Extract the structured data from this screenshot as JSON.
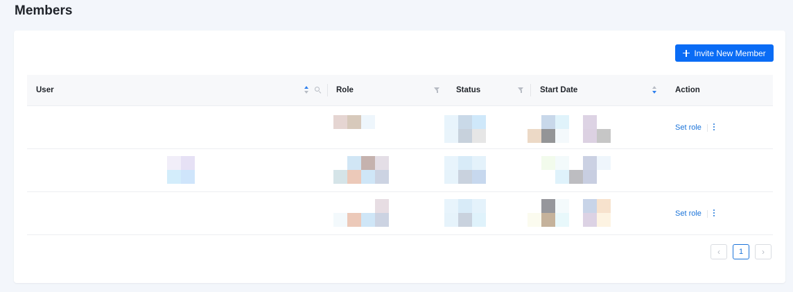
{
  "page": {
    "title": "Members"
  },
  "toolbar": {
    "invite_label": "Invite New Member"
  },
  "table": {
    "columns": [
      "User",
      "Role",
      "Status",
      "Start Date",
      "Action"
    ],
    "rows": [
      {
        "action": "Set role"
      },
      {
        "action": ""
      },
      {
        "action": "Set role"
      }
    ]
  },
  "pagination": {
    "prev": "‹",
    "current": "1",
    "next": "›"
  },
  "colors": {
    "accent": "#0a6cf5",
    "link": "#1a73d9",
    "background": "#f3f6fb"
  }
}
